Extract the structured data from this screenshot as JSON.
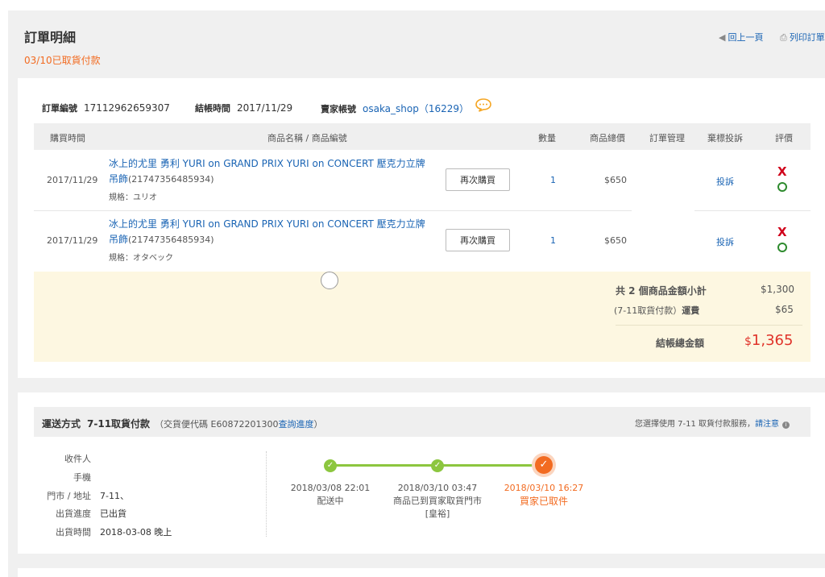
{
  "header": {
    "title": "訂單明細",
    "status": "03/10已取貨付款",
    "back_label": "回上一頁",
    "print_label": "列印訂單"
  },
  "order": {
    "number_label": "訂單編號",
    "number": "17112962659307",
    "checkout_label": "結帳時間",
    "checkout_time": "2017/11/29",
    "seller_label": "賣家帳號",
    "seller": "osaka_shop（16229）"
  },
  "table": {
    "headers": [
      "購買時間",
      "商品名稱 / 商品編號",
      "數量",
      "商品總價",
      "訂單管理",
      "棄標投訴",
      "評價"
    ],
    "rows": [
      {
        "date": "2017/11/29",
        "name_line1": "冰上的尤里 勇利 YURI on GRAND PRIX YURI on CONCERT 壓克力立牌",
        "name_line2": "吊飾",
        "item_id": "(21747356485934)",
        "spec": "規格：ユリオ",
        "rebuy": "再次購買",
        "qty": "1",
        "price": "$650",
        "complaint": "投訴"
      },
      {
        "date": "2017/11/29",
        "name_line1": "冰上的尤里 勇利 YURI on GRAND PRIX YURI on CONCERT 壓克力立牌",
        "name_line2": "吊飾",
        "item_id": "(21747356485934)",
        "spec": "規格：オタベック",
        "rebuy": "再次購買",
        "qty": "1",
        "price": "$650",
        "complaint": "投訴"
      }
    ]
  },
  "summary": {
    "subtotal_label": "共 2 個商品金額小計",
    "subtotal": "$1,300",
    "shipping_prefix": "(7-11取貨付款）",
    "shipping_label": "運費",
    "shipping": "$65",
    "total_label": "結帳總金額",
    "total_currency": "$",
    "total": "1,365"
  },
  "shipping": {
    "method_label": "運送方式",
    "method": "7-11取貨付款",
    "code_prefix": "（交貨便代碼 E60872201300",
    "track_link": "查詢進度",
    "code_suffix": "）",
    "notice": "您選擇使用 7-11 取貨付款服務，",
    "notice_link": "請注意",
    "fields": [
      {
        "label": "收件人",
        "value": ""
      },
      {
        "label": "手機",
        "value": ""
      },
      {
        "label": "門市 / 地址",
        "value": "7-11、"
      },
      {
        "label": "出貨進度",
        "value": "已出貨"
      },
      {
        "label": "出貨時間",
        "value": "2018-03-08 晚上"
      }
    ],
    "timeline": [
      {
        "time": "2018/03/08 22:01",
        "status": "配送中",
        "status2": ""
      },
      {
        "time": "2018/03/10 03:47",
        "status": "商品已到買家取貨門市",
        "status2": "[皇裕]"
      },
      {
        "time": "2018/03/10 16:27",
        "status": "買家已取件",
        "status2": ""
      }
    ]
  },
  "colors": {
    "accent_orange": "#f26b21",
    "link_blue": "#1a64b4",
    "total_red": "#e0332a",
    "timeline_green": "#8cc63f"
  }
}
